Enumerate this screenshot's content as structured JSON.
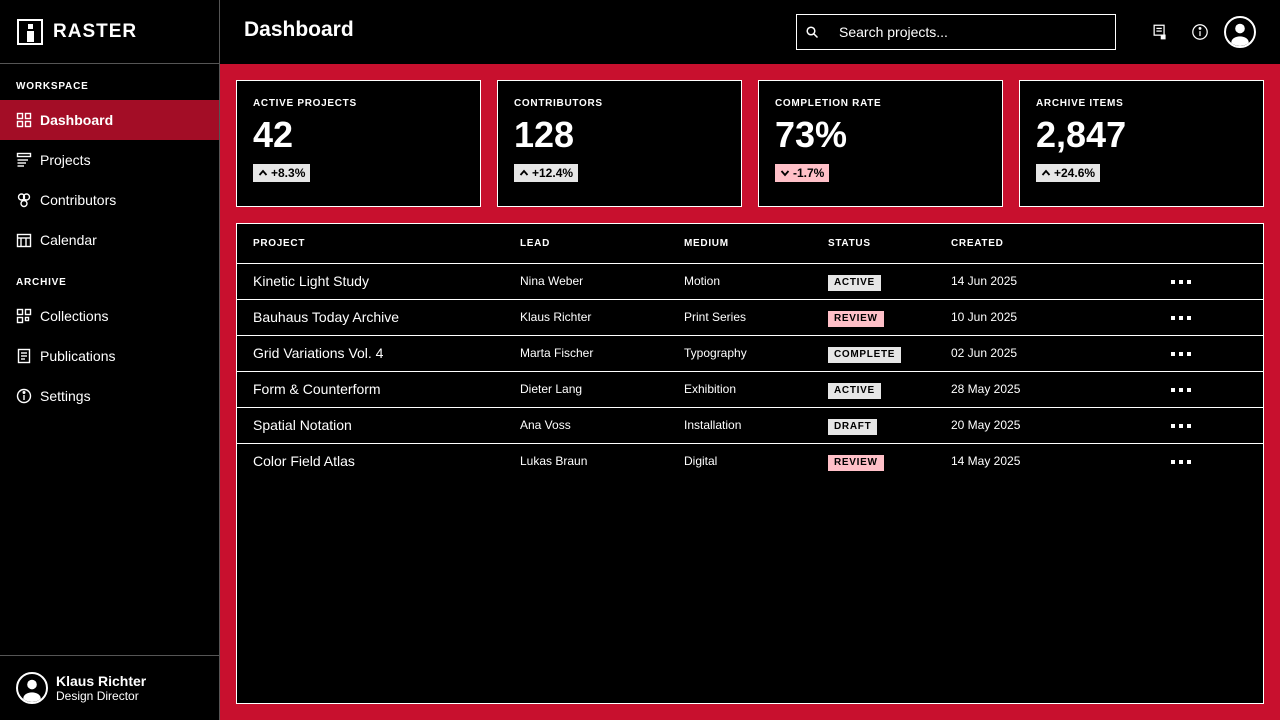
{
  "brand": {
    "name": "RASTER"
  },
  "sidebar": {
    "sections": [
      {
        "label": "WORKSPACE",
        "items": [
          {
            "label": "Dashboard",
            "icon": "grid-icon",
            "active": true
          },
          {
            "label": "Projects",
            "icon": "list-icon",
            "active": false
          },
          {
            "label": "Contributors",
            "icon": "people-icon",
            "active": false
          },
          {
            "label": "Calendar",
            "icon": "calendar-icon",
            "active": false
          }
        ]
      },
      {
        "label": "ARCHIVE",
        "items": [
          {
            "label": "Collections",
            "icon": "collections-icon",
            "active": false
          },
          {
            "label": "Publications",
            "icon": "document-icon",
            "active": false
          },
          {
            "label": "Settings",
            "icon": "info-circle-icon",
            "active": false
          }
        ]
      }
    ],
    "user": {
      "name": "Klaus Richter",
      "role": "Design Director"
    }
  },
  "header": {
    "title": "Dashboard",
    "search": {
      "placeholder": "Search projects...",
      "value": ""
    }
  },
  "stats": [
    {
      "label": "ACTIVE PROJECTS",
      "value": "42",
      "delta": "+8.3%",
      "direction": "up"
    },
    {
      "label": "CONTRIBUTORS",
      "value": "128",
      "delta": "+12.4%",
      "direction": "up"
    },
    {
      "label": "COMPLETION RATE",
      "value": "73%",
      "delta": "-1.7%",
      "direction": "down"
    },
    {
      "label": "ARCHIVE ITEMS",
      "value": "2,847",
      "delta": "+24.6%",
      "direction": "up"
    }
  ],
  "table": {
    "columns": [
      "PROJECT",
      "LEAD",
      "MEDIUM",
      "STATUS",
      "CREATED"
    ],
    "rows": [
      {
        "project": "Kinetic Light Study",
        "lead": "Nina Weber",
        "medium": "Motion",
        "status": "ACTIVE",
        "created": "14 Jun 2025"
      },
      {
        "project": "Bauhaus Today Archive",
        "lead": "Klaus Richter",
        "medium": "Print Series",
        "status": "REVIEW",
        "created": "10 Jun 2025"
      },
      {
        "project": "Grid Variations Vol. 4",
        "lead": "Marta Fischer",
        "medium": "Typography",
        "status": "COMPLETE",
        "created": "02 Jun 2025"
      },
      {
        "project": "Form & Counterform",
        "lead": "Dieter Lang",
        "medium": "Exhibition",
        "status": "ACTIVE",
        "created": "28 May 2025"
      },
      {
        "project": "Spatial Notation",
        "lead": "Ana Voss",
        "medium": "Installation",
        "status": "DRAFT",
        "created": "20 May 2025"
      },
      {
        "project": "Color Field Atlas",
        "lead": "Lukas Braun",
        "medium": "Digital",
        "status": "REVIEW",
        "created": "14 May 2025"
      }
    ]
  },
  "colors": {
    "accent": "#c8102e",
    "active_nav": "#a30d26",
    "badge_neutral": "#e6e6e6",
    "badge_review": "#ffc0c8",
    "delta_down": "#ffc0c8"
  }
}
